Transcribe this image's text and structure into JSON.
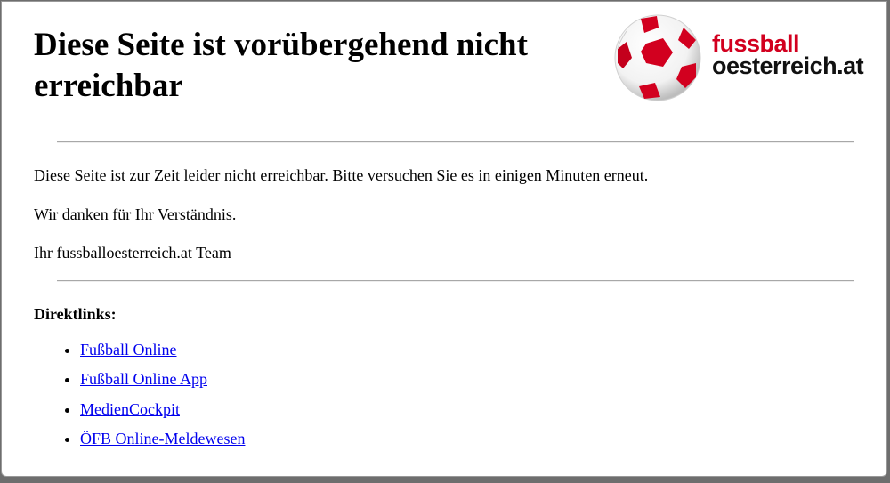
{
  "page": {
    "title": "Diese Seite ist vorübergehend nicht erreichbar",
    "logo": {
      "line1": "fussball",
      "line2": "oesterreich.at"
    },
    "messages": [
      "Diese Seite ist zur Zeit leider nicht erreichbar. Bitte versuchen Sie es in einigen Minuten erneut.",
      "Wir danken für Ihr Verständnis.",
      "Ihr fussballoesterreich.at Team"
    ],
    "direct_links": {
      "heading": "Direktlinks:",
      "items": [
        {
          "label": "Fußball Online"
        },
        {
          "label": "Fußball Online App"
        },
        {
          "label": "MedienCockpit"
        },
        {
          "label": "ÖFB Online-Meldewesen"
        }
      ]
    }
  },
  "colors": {
    "link": "#0000ee",
    "brand_red": "#d2001f",
    "frame": "#6e6e6e"
  }
}
